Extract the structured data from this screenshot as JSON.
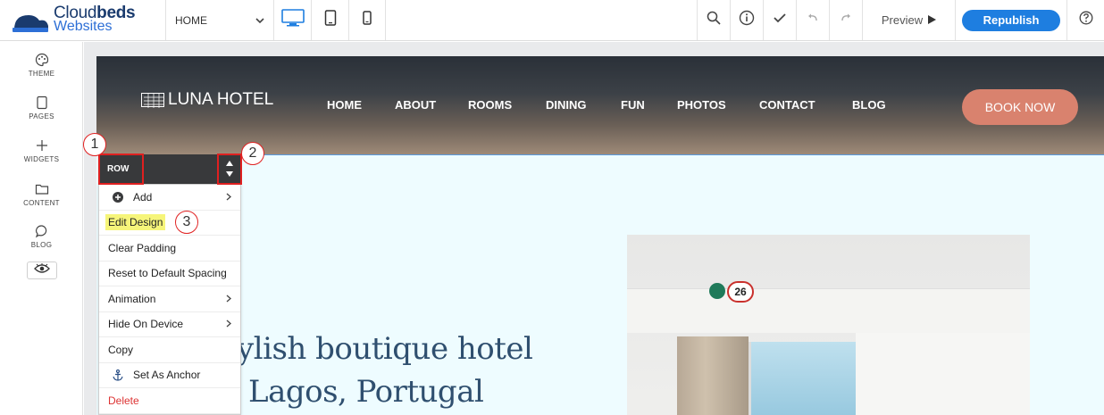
{
  "brand": {
    "line1_regular": "Cloud",
    "line1_bold": "beds",
    "line2": "Websites"
  },
  "page_selector": {
    "value": "HOME"
  },
  "toolbar": {
    "preview_label": "Preview",
    "republish_label": "Republish"
  },
  "sidebar": {
    "items": [
      {
        "label": "THEME",
        "icon": "palette-icon"
      },
      {
        "label": "PAGES",
        "icon": "page-icon"
      },
      {
        "label": "WIDGETS",
        "icon": "plus-icon"
      },
      {
        "label": "CONTENT",
        "icon": "folder-icon"
      },
      {
        "label": "BLOG",
        "icon": "chat-bubble-icon"
      }
    ]
  },
  "site": {
    "hotel_name": "LUNA HOTEL",
    "nav": [
      "HOME",
      "ABOUT",
      "ROOMS",
      "DINING",
      "FUN",
      "PHOTOS",
      "CONTACT",
      "BLOG"
    ],
    "book_now": "BOOK NOW",
    "headline_line1": "ylish boutique hotel",
    "headline_line2": "Lagos, Portugal",
    "badge_count": "26"
  },
  "row_toolbar": {
    "label": "ROW"
  },
  "context_menu": {
    "items": [
      {
        "label": "Add",
        "has_submenu": true,
        "icon": "add-circle-icon"
      },
      {
        "label": "Edit Design",
        "highlighted": true
      },
      {
        "label": "Clear Padding"
      },
      {
        "label": "Reset to Default Spacing"
      },
      {
        "label": "Animation",
        "has_submenu": true
      },
      {
        "label": "Hide On Device",
        "has_submenu": true
      },
      {
        "label": "Copy"
      },
      {
        "label": "Set As Anchor",
        "icon": "anchor-icon"
      },
      {
        "label": "Delete",
        "danger": true
      }
    ]
  },
  "callouts": [
    "1",
    "2",
    "3"
  ],
  "colors": {
    "accent": "#1e7ee0",
    "book_button": "#d9826e",
    "highlight": "#f6f57a",
    "annotation": "#e02020"
  }
}
